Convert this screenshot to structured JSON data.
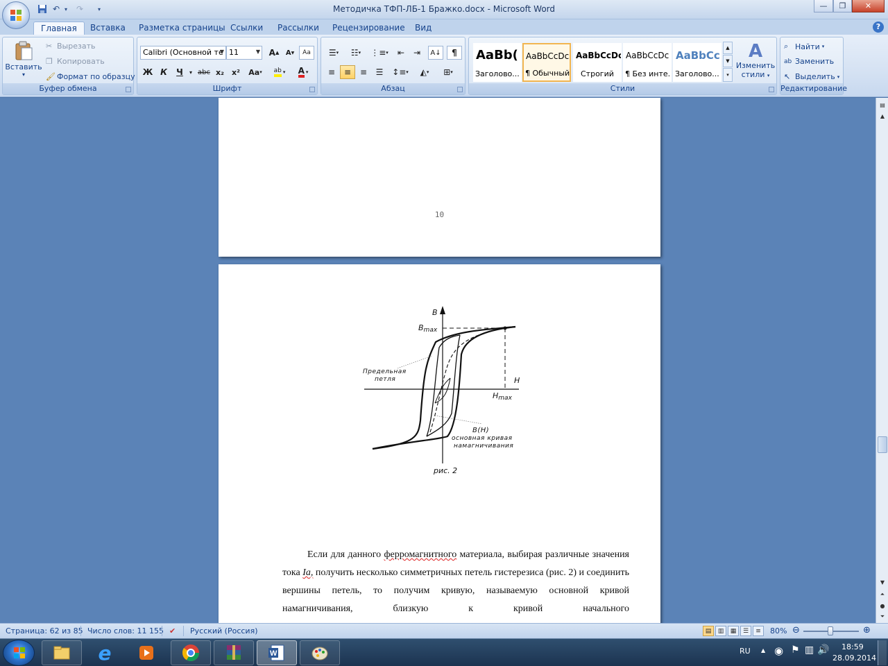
{
  "window": {
    "title": "Методичка ТФП-ЛБ-1 Бражко.docx - Microsoft Word",
    "minimize": "—",
    "maximize": "❐",
    "close": "✕"
  },
  "quick_access": {
    "save_icon": "save-icon",
    "undo_icon": "undo-icon",
    "redo_icon": "redo-icon",
    "customize_icon": "dropdown-arrow-icon"
  },
  "tabs": [
    "Главная",
    "Вставка",
    "Разметка страницы",
    "Ссылки",
    "Рассылки",
    "Рецензирование",
    "Вид"
  ],
  "active_tab": "Главная",
  "ribbon": {
    "clipboard": {
      "label": "Буфер обмена",
      "paste": "Вставить",
      "cut": "Вырезать",
      "copy": "Копировать",
      "format_painter": "Формат по образцу"
    },
    "font": {
      "label": "Шрифт",
      "font_name": "Calibri (Основной те",
      "font_size": "11",
      "grow": "A",
      "shrink": "A",
      "clear": "Aa",
      "bold": "Ж",
      "italic": "К",
      "underline": "Ч",
      "strike": "abc",
      "subscript": "x₂",
      "superscript": "x²",
      "change_case": "Aa",
      "highlight": "ab",
      "font_color": "A"
    },
    "paragraph": {
      "label": "Абзац",
      "show_marks": "¶"
    },
    "styles": {
      "label": "Стили",
      "items": [
        {
          "sample": "AaBb(",
          "name": "Заголово..."
        },
        {
          "sample": "AaBbCcDc",
          "name": "¶ Обычный"
        },
        {
          "sample": "AaBbCcDc",
          "name": "Строгий"
        },
        {
          "sample": "AaBbCcDc",
          "name": "¶ Без инте..."
        },
        {
          "sample": "AaBbCc",
          "name": "Заголово..."
        }
      ],
      "change_styles_1": "Изменить",
      "change_styles_2": "стили"
    },
    "editing": {
      "label": "Редактирование",
      "find": "Найти",
      "replace": "Заменить",
      "select": "Выделить"
    }
  },
  "document": {
    "page_number": "10",
    "figure": {
      "label_B": "B",
      "label_Bmax": "B",
      "label_Bmax_sub": "max",
      "label_H": "H",
      "label_Hmax": "H",
      "label_Hmax_sub": "max",
      "label_limit_loop_1": "Предельная",
      "label_limit_loop_2": "петля",
      "label_BH": "B(H)",
      "label_curve_1": "основная кривая",
      "label_curve_2": "намагничивания",
      "caption": "рис. 2"
    },
    "paragraph": {
      "part1": "Если для данного ",
      "word_ferro": "ферромагнитного",
      "part2": " материала, выбирая различные значения тока ",
      "word_Ia": "Ia,",
      "part3": " получить несколько симметричных петель гистерезиса (рис. 2) и соединить вершины петель, то получим кривую, называемую основной кривой намагничивания, близкую к кривой начального"
    }
  },
  "status": {
    "page": "Страница: 62 из 85",
    "words": "Число слов: 11 155",
    "language": "Русский (Россия)",
    "zoom": "80%",
    "zoom_level": 0.8
  },
  "taskbar": {
    "apps": [
      "windows-explorer-icon",
      "internet-explorer-icon",
      "media-player-icon",
      "chrome-icon",
      "winrar-icon",
      "word-icon",
      "paint-icon"
    ],
    "lang": "RU",
    "time": "18:59",
    "date": "28.09.2014"
  },
  "colors": {
    "ribbon_bg": "#d5e2f3",
    "doc_bg": "#5b83b7",
    "selected_style": "#f2b550"
  }
}
